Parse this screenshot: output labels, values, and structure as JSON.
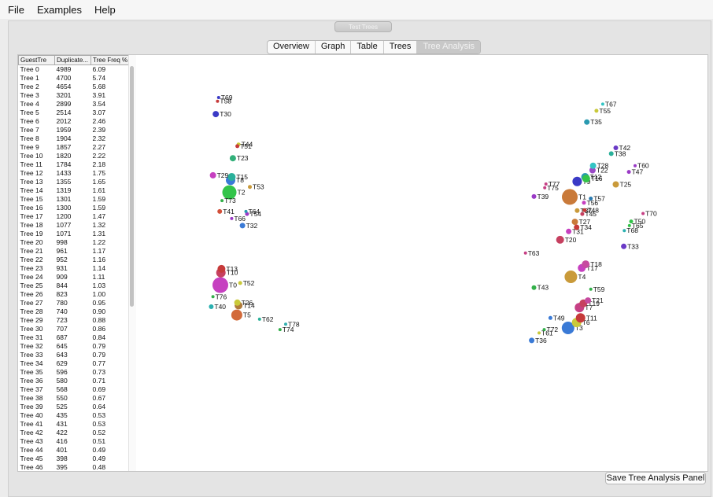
{
  "menu": [
    "File",
    "Examples",
    "Help"
  ],
  "toolbar": {
    "run_label": "Test Trees"
  },
  "tabs": [
    "Overview",
    "Graph",
    "Table",
    "Trees",
    "Tree Analysis"
  ],
  "active_tab": 4,
  "table": {
    "headers": [
      "GuestTre",
      "Duplicate...",
      "Tree Freq %"
    ],
    "rows": [
      [
        "Tree 0",
        "4989",
        "6.09"
      ],
      [
        "Tree 1",
        "4700",
        "5.74"
      ],
      [
        "Tree 2",
        "4654",
        "5.68"
      ],
      [
        "Tree 3",
        "3201",
        "3.91"
      ],
      [
        "Tree 4",
        "2899",
        "3.54"
      ],
      [
        "Tree 5",
        "2514",
        "3.07"
      ],
      [
        "Tree 6",
        "2012",
        "2.46"
      ],
      [
        "Tree 7",
        "1959",
        "2.39"
      ],
      [
        "Tree 8",
        "1904",
        "2.32"
      ],
      [
        "Tree 9",
        "1857",
        "2.27"
      ],
      [
        "Tree 10",
        "1820",
        "2.22"
      ],
      [
        "Tree 11",
        "1784",
        "2.18"
      ],
      [
        "Tree 12",
        "1433",
        "1.75"
      ],
      [
        "Tree 13",
        "1355",
        "1.65"
      ],
      [
        "Tree 14",
        "1319",
        "1.61"
      ],
      [
        "Tree 15",
        "1301",
        "1.59"
      ],
      [
        "Tree 16",
        "1300",
        "1.59"
      ],
      [
        "Tree 17",
        "1200",
        "1.47"
      ],
      [
        "Tree 18",
        "1077",
        "1.32"
      ],
      [
        "Tree 19",
        "1071",
        "1.31"
      ],
      [
        "Tree 20",
        "998",
        "1.22"
      ],
      [
        "Tree 21",
        "961",
        "1.17"
      ],
      [
        "Tree 22",
        "952",
        "1.16"
      ],
      [
        "Tree 23",
        "931",
        "1.14"
      ],
      [
        "Tree 24",
        "909",
        "1.11"
      ],
      [
        "Tree 25",
        "844",
        "1.03"
      ],
      [
        "Tree 26",
        "823",
        "1.00"
      ],
      [
        "Tree 27",
        "780",
        "0.95"
      ],
      [
        "Tree 28",
        "740",
        "0.90"
      ],
      [
        "Tree 29",
        "723",
        "0.88"
      ],
      [
        "Tree 30",
        "707",
        "0.86"
      ],
      [
        "Tree 31",
        "687",
        "0.84"
      ],
      [
        "Tree 32",
        "645",
        "0.79"
      ],
      [
        "Tree 33",
        "643",
        "0.79"
      ],
      [
        "Tree 34",
        "629",
        "0.77"
      ],
      [
        "Tree 35",
        "596",
        "0.73"
      ],
      [
        "Tree 36",
        "580",
        "0.71"
      ],
      [
        "Tree 37",
        "568",
        "0.69"
      ],
      [
        "Tree 38",
        "550",
        "0.67"
      ],
      [
        "Tree 39",
        "525",
        "0.64"
      ],
      [
        "Tree 40",
        "435",
        "0.53"
      ],
      [
        "Tree 41",
        "431",
        "0.53"
      ],
      [
        "Tree 42",
        "422",
        "0.52"
      ],
      [
        "Tree 43",
        "416",
        "0.51"
      ],
      [
        "Tree 44",
        "401",
        "0.49"
      ],
      [
        "Tree 45",
        "398",
        "0.49"
      ],
      [
        "Tree 46",
        "395",
        "0.48"
      ]
    ]
  },
  "save_label": "Save Tree Analysis Panel",
  "chart_data": {
    "type": "scatter",
    "title": "",
    "xlabel": "",
    "ylabel": "",
    "note": "Unlabeled tree-space projection; x/y are relative positions read from the plot (0-100 scale, y increasing downward).",
    "points": [
      {
        "label": "T0",
        "x": 14.4,
        "y": 55.3,
        "color": "#c640c0"
      },
      {
        "label": "T1",
        "x": 75.9,
        "y": 34.1,
        "color": "#c97a3a"
      },
      {
        "label": "T2",
        "x": 16.0,
        "y": 33.0,
        "color": "#33c44a"
      },
      {
        "label": "T3",
        "x": 75.6,
        "y": 65.6,
        "color": "#3a7ad6"
      },
      {
        "label": "T4",
        "x": 76.1,
        "y": 53.3,
        "color": "#c99a3a"
      },
      {
        "label": "T5",
        "x": 17.3,
        "y": 62.5,
        "color": "#d26a3a"
      },
      {
        "label": "T6",
        "x": 77.1,
        "y": 64.3,
        "color": "#c9c93a"
      },
      {
        "label": "T7",
        "x": 77.6,
        "y": 60.7,
        "color": "#c64085"
      },
      {
        "label": "T8",
        "x": 16.2,
        "y": 30.1,
        "color": "#3a7ad6"
      },
      {
        "label": "T9",
        "x": 77.2,
        "y": 30.4,
        "color": "#3a3ac6"
      },
      {
        "label": "T10",
        "x": 14.5,
        "y": 52.3,
        "color": "#c64060"
      },
      {
        "label": "T11",
        "x": 77.8,
        "y": 63.2,
        "color": "#c63a3a"
      },
      {
        "label": "T12",
        "x": 78.6,
        "y": 29.3,
        "color": "#2a9ab0"
      },
      {
        "label": "T13",
        "x": 14.6,
        "y": 51.4,
        "color": "#c63a3a"
      },
      {
        "label": "T14",
        "x": 17.6,
        "y": 60.2,
        "color": "#b07a3a"
      },
      {
        "label": "T15",
        "x": 16.4,
        "y": 29.3,
        "color": "#2ab09a"
      },
      {
        "label": "T16",
        "x": 78.8,
        "y": 29.7,
        "color": "#33c44a"
      },
      {
        "label": "T17",
        "x": 78.0,
        "y": 51.2,
        "color": "#c640c0"
      },
      {
        "label": "T18",
        "x": 78.7,
        "y": 50.3,
        "color": "#c64aa0"
      },
      {
        "label": "T19",
        "x": 78.3,
        "y": 59.7,
        "color": "#c64060"
      },
      {
        "label": "T20",
        "x": 74.2,
        "y": 44.4,
        "color": "#c64060"
      },
      {
        "label": "T21",
        "x": 79.1,
        "y": 59.0,
        "color": "#c64aa0"
      },
      {
        "label": "T22",
        "x": 79.9,
        "y": 27.7,
        "color": "#9a4ac6"
      },
      {
        "label": "T23",
        "x": 16.6,
        "y": 24.8,
        "color": "#33b07a"
      },
      {
        "label": "T25",
        "x": 84.0,
        "y": 31.1,
        "color": "#c99a3a"
      },
      {
        "label": "T26",
        "x": 17.4,
        "y": 59.5,
        "color": "#c9c93a"
      },
      {
        "label": "T27",
        "x": 76.8,
        "y": 40.1,
        "color": "#c97a3a"
      },
      {
        "label": "T28",
        "x": 80.0,
        "y": 26.6,
        "color": "#33c4c4"
      },
      {
        "label": "T29",
        "x": 13.1,
        "y": 28.9,
        "color": "#c640c0"
      },
      {
        "label": "T30",
        "x": 13.6,
        "y": 14.2,
        "color": "#3a3ac6"
      },
      {
        "label": "T31",
        "x": 75.7,
        "y": 42.4,
        "color": "#c640c0"
      },
      {
        "label": "T32",
        "x": 18.3,
        "y": 41.0,
        "color": "#3a7ad6"
      },
      {
        "label": "T33",
        "x": 85.4,
        "y": 46.0,
        "color": "#6a3ac6"
      },
      {
        "label": "T34",
        "x": 77.1,
        "y": 41.4,
        "color": "#c63a3a"
      },
      {
        "label": "T35",
        "x": 78.9,
        "y": 16.1,
        "color": "#2a9ab0"
      },
      {
        "label": "T36",
        "x": 69.2,
        "y": 68.6,
        "color": "#3a7ad6"
      },
      {
        "label": "T37",
        "x": 77.2,
        "y": 37.4,
        "color": "#c99a3a"
      },
      {
        "label": "T38",
        "x": 83.2,
        "y": 23.7,
        "color": "#2ab09a"
      },
      {
        "label": "T39",
        "x": 69.6,
        "y": 34.0,
        "color": "#9a3ac6"
      },
      {
        "label": "T40",
        "x": 12.8,
        "y": 60.5,
        "color": "#2ab0b0"
      },
      {
        "label": "T41",
        "x": 14.3,
        "y": 37.6,
        "color": "#d2503a"
      },
      {
        "label": "T42",
        "x": 84.0,
        "y": 22.3,
        "color": "#6a3ac6"
      },
      {
        "label": "T43",
        "x": 69.6,
        "y": 55.9,
        "color": "#33b04a"
      },
      {
        "label": "T44",
        "x": 17.6,
        "y": 21.5,
        "color": "#c9c93a"
      },
      {
        "label": "T45",
        "x": 78.1,
        "y": 38.2,
        "color": "#c64060"
      },
      {
        "label": "T47",
        "x": 86.3,
        "y": 28.1,
        "color": "#9a3ac6"
      },
      {
        "label": "T48",
        "x": 78.5,
        "y": 37.3,
        "color": "#c63a3a"
      },
      {
        "label": "T49",
        "x": 72.5,
        "y": 63.2,
        "color": "#3a7ad6"
      },
      {
        "label": "T50",
        "x": 86.7,
        "y": 40.0,
        "color": "#33c44a"
      },
      {
        "label": "T51",
        "x": 17.4,
        "y": 21.9,
        "color": "#c63a3a"
      },
      {
        "label": "T52",
        "x": 17.9,
        "y": 54.8,
        "color": "#c9c93a"
      },
      {
        "label": "T53",
        "x": 19.6,
        "y": 31.7,
        "color": "#c99a3a"
      },
      {
        "label": "T54",
        "x": 19.1,
        "y": 38.2,
        "color": "#9a3ac6"
      },
      {
        "label": "T55",
        "x": 80.6,
        "y": 13.4,
        "color": "#c9c93a"
      },
      {
        "label": "T56",
        "x": 78.4,
        "y": 35.5,
        "color": "#c640c0"
      },
      {
        "label": "T57",
        "x": 79.6,
        "y": 34.5,
        "color": "#2a7ab0"
      },
      {
        "label": "T58",
        "x": 13.9,
        "y": 11.1,
        "color": "#c63a3a"
      },
      {
        "label": "T59",
        "x": 79.6,
        "y": 56.3,
        "color": "#33b04a"
      },
      {
        "label": "T60",
        "x": 87.4,
        "y": 26.6,
        "color": "#9a3ac6"
      },
      {
        "label": "T61",
        "x": 70.5,
        "y": 66.8,
        "color": "#c9c93a"
      },
      {
        "label": "T62",
        "x": 21.3,
        "y": 63.5,
        "color": "#2ab09a"
      },
      {
        "label": "T63",
        "x": 68.1,
        "y": 47.6,
        "color": "#c64085"
      },
      {
        "label": "T64",
        "x": 18.9,
        "y": 37.6,
        "color": "#2a9ab0"
      },
      {
        "label": "T65",
        "x": 86.4,
        "y": 41.0,
        "color": "#33c44a"
      },
      {
        "label": "T66",
        "x": 16.4,
        "y": 39.3,
        "color": "#9a3ac6"
      },
      {
        "label": "T67",
        "x": 81.7,
        "y": 11.8,
        "color": "#33c4c4"
      },
      {
        "label": "T68",
        "x": 85.5,
        "y": 42.2,
        "color": "#2ab0b0"
      },
      {
        "label": "T69",
        "x": 14.1,
        "y": 10.2,
        "color": "#3a3ac6"
      },
      {
        "label": "T70",
        "x": 88.8,
        "y": 38.1,
        "color": "#c64085"
      },
      {
        "label": "T72",
        "x": 71.4,
        "y": 66.0,
        "color": "#33b04a"
      },
      {
        "label": "T73",
        "x": 14.7,
        "y": 35.0,
        "color": "#33b04a"
      },
      {
        "label": "T74",
        "x": 24.9,
        "y": 66.0,
        "color": "#33b04a"
      },
      {
        "label": "T75",
        "x": 71.5,
        "y": 31.9,
        "color": "#c64085"
      },
      {
        "label": "T76",
        "x": 13.1,
        "y": 58.1,
        "color": "#33b04a"
      },
      {
        "label": "T77",
        "x": 71.7,
        "y": 31.0,
        "color": "#c64085"
      },
      {
        "label": "T78",
        "x": 25.9,
        "y": 64.7,
        "color": "#33b0b0"
      }
    ],
    "sizes": {
      "T0": 10,
      "T1": 10,
      "T2": 9,
      "T3": 8,
      "T4": 8,
      "T5": 7,
      "T6": 6,
      "T7": 6,
      "T8": 6,
      "T9": 6,
      "T10": 6,
      "T11": 6,
      "T12": 5,
      "T13": 5,
      "T14": 5,
      "T15": 5,
      "T16": 5,
      "T17": 5,
      "T18": 5,
      "T19": 5,
      "T20": 5,
      "T21": 4,
      "T22": 4,
      "T23": 4,
      "T25": 4,
      "T26": 4,
      "T27": 4,
      "T28": 4,
      "T29": 4,
      "T30": 4,
      "T31": 3.5,
      "T32": 3.5,
      "T33": 3.5,
      "T34": 3.5,
      "T35": 3.5,
      "T36": 3.5,
      "T37": 3,
      "T38": 3,
      "T39": 3,
      "T40": 3,
      "T41": 3,
      "T42": 3,
      "T43": 3,
      "T44": 2.5,
      "T45": 2.5,
      "T47": 2.5,
      "T48": 2.5,
      "T49": 2.5,
      "T50": 2.5,
      "T51": 2.5,
      "T52": 2.5,
      "T53": 2.5,
      "T54": 2.5,
      "T55": 2.5,
      "T56": 2.5,
      "T57": 2.5,
      "T58": 2,
      "T59": 2,
      "T60": 2,
      "T61": 2,
      "T62": 2,
      "T63": 2,
      "T64": 2,
      "T65": 2,
      "T66": 2,
      "T67": 2,
      "T68": 2,
      "T69": 2,
      "T70": 2,
      "T72": 2,
      "T73": 2,
      "T74": 2,
      "T75": 2,
      "T76": 2,
      "T77": 2,
      "T78": 2
    }
  }
}
